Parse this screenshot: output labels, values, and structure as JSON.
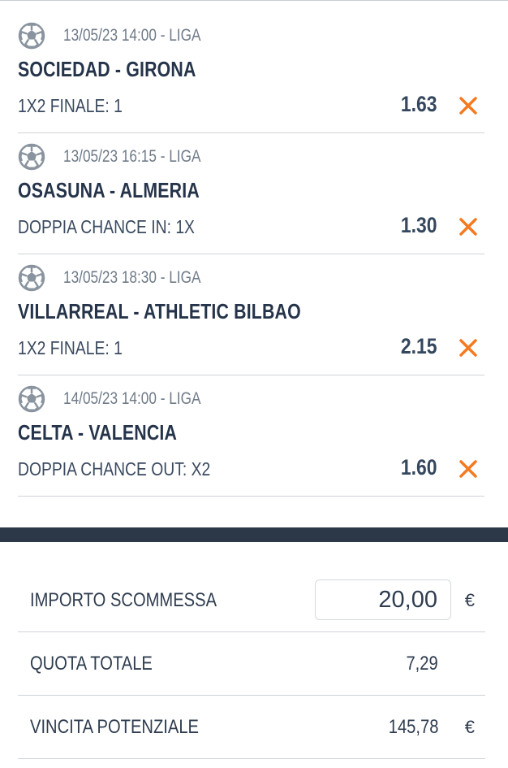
{
  "bets": [
    {
      "date": "13/05/23 14:00 - LIGA",
      "match": "SOCIEDAD - GIRONA",
      "market": "1X2 FINALE: 1",
      "odd": "1.63"
    },
    {
      "date": "13/05/23 16:15 - LIGA",
      "match": "OSASUNA - ALMERIA",
      "market": "DOPPIA CHANCE IN: 1X",
      "odd": "1.30"
    },
    {
      "date": "13/05/23 18:30 - LIGA",
      "match": "VILLARREAL - ATHLETIC BILBAO",
      "market": "1X2 FINALE: 1",
      "odd": "2.15"
    },
    {
      "date": "14/05/23 14:00 - LIGA",
      "match": "CELTA - VALENCIA",
      "market": "DOPPIA CHANCE OUT: X2",
      "odd": "1.60"
    }
  ],
  "summary": {
    "stake_label": "IMPORTO SCOMMESSA",
    "stake_value": "20,00",
    "currency": "€",
    "total_odds_label": "QUOTA TOTALE",
    "total_odds_value": "7,29",
    "potential_win_label": "VINCITA POTENZIALE",
    "potential_win_value": "145,78"
  },
  "icons": {
    "sport": "soccer-ball-icon",
    "remove": "close-x-icon"
  },
  "colors": {
    "accent": "#f47a20",
    "dark_bar": "#2c3847",
    "text": "#2b3a4e"
  }
}
